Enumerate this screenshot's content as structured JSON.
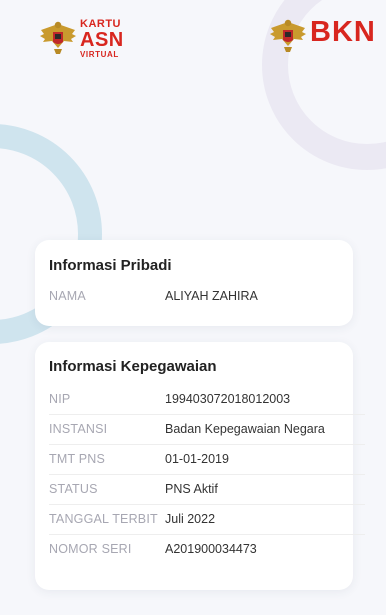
{
  "header": {
    "left_logo": {
      "icon": "garuda-emblem-icon",
      "line1": "KARTU",
      "line2": "ASN",
      "line3": "VIRTUAL"
    },
    "right_logo": {
      "icon": "garuda-emblem-icon",
      "text": "BKN"
    }
  },
  "personal_info": {
    "title": "Informasi Pribadi",
    "rows": [
      {
        "label": "NAMA",
        "value": "ALIYAH ZAHIRA"
      }
    ]
  },
  "employment_info": {
    "title": "Informasi Kepegawaian",
    "rows": [
      {
        "label": "NIP",
        "value": "199403072018012003"
      },
      {
        "label": "INSTANSI",
        "value": "Badan Kepegawaian Negara"
      },
      {
        "label": "TMT PNS",
        "value": "01-01-2019"
      },
      {
        "label": "STATUS",
        "value": "PNS Aktif"
      },
      {
        "label": "TANGGAL TERBIT",
        "value": "Juli 2022"
      },
      {
        "label": "NOMOR SERI",
        "value": "A201900034473"
      }
    ]
  },
  "colors": {
    "brand_red": "#d8261f",
    "background": "#f6f7fb",
    "ring_blue": "#cfe4ee",
    "ring_lavender": "#ebe9f3"
  }
}
